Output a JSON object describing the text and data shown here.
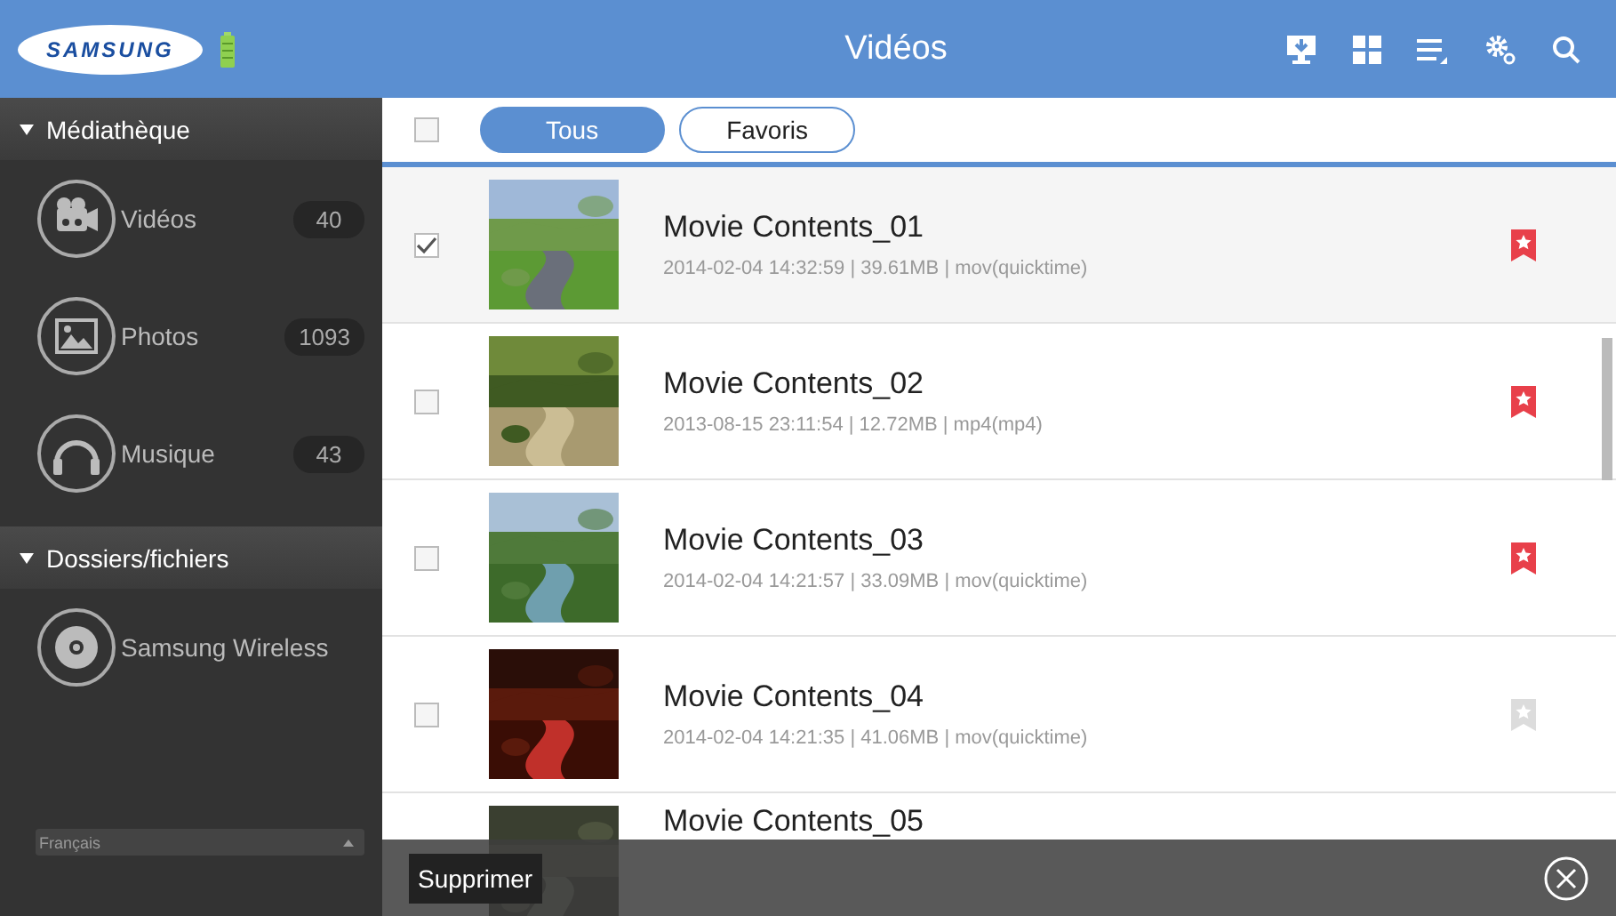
{
  "header": {
    "logo": "SAMSUNG",
    "title": "Vidéos",
    "toolbar": [
      {
        "kind": "download"
      },
      {
        "kind": "grid"
      },
      {
        "kind": "list"
      },
      {
        "kind": "settings"
      },
      {
        "kind": "search"
      }
    ]
  },
  "sidebar": {
    "sections": [
      {
        "title": "Médiathèque",
        "expanded": true,
        "items": [
          {
            "kind": "video",
            "label": "Vidéos",
            "count": "40"
          },
          {
            "label": "Photos",
            "count": "1093"
          },
          {
            "kind": "music",
            "label": "Musique",
            "count": "43"
          }
        ]
      },
      {
        "title": "Dossiers/fichiers",
        "expanded": true,
        "items": [
          {
            "kind": "disc",
            "label": "Samsung Wireless"
          }
        ]
      }
    ],
    "language": "Français"
  },
  "filters": [
    {
      "label": "Tous",
      "selected": true
    },
    {
      "label": "Favoris",
      "selected": false
    }
  ],
  "select_all": {
    "checked": false
  },
  "videos": [
    {
      "title": "Movie Contents_01",
      "meta": "2014-02-04 14:32:59 | 39.61MB | mov(quicktime)",
      "checked": true,
      "favorite": true
    },
    {
      "title": "Movie Contents_02",
      "meta": "2013-08-15 23:11:54 | 12.72MB | mp4(mp4)",
      "checked": false,
      "favorite": true
    },
    {
      "title": "Movie Contents_03",
      "meta": "2014-02-04 14:21:57 | 33.09MB | mov(quicktime)",
      "checked": false,
      "favorite": true
    },
    {
      "title": "Movie Contents_04",
      "meta": "2014-02-04 14:21:35 | 41.06MB | mov(quicktime)",
      "checked": false,
      "favorite": false
    },
    {
      "title": "Movie Contents_05"
    }
  ],
  "action_bar": {
    "delete_button": "Supprimer"
  }
}
